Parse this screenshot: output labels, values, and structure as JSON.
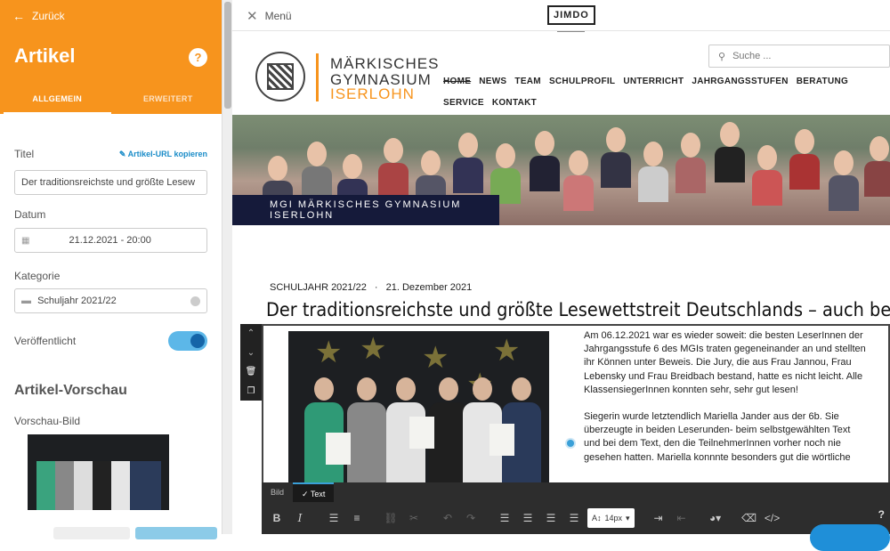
{
  "sidebar": {
    "back_label": "Zurück",
    "title": "Artikel",
    "help_label": "?",
    "tabs": [
      "ALLGEMEIN",
      "ERWEITERT"
    ],
    "title_field_label": "Titel",
    "copy_url_label": "Artikel-URL kopieren",
    "title_value": "Der traditionsreichste und größte Lesew",
    "date_label": "Datum",
    "date_value": "21.12.2021 - 20:00",
    "category_label": "Kategorie",
    "category_value": "Schuljahr 2021/22",
    "published_label": "Veröffentlicht",
    "published": true,
    "preview_heading": "Artikel-Vorschau",
    "preview_image_label": "Vorschau-Bild"
  },
  "topbar": {
    "menu_label": "Menü",
    "brand": "JIMDO"
  },
  "site": {
    "logo": [
      "MÄRKISCHES",
      "GYMNASIUM",
      "ISERLOHN"
    ],
    "search_placeholder": "Suche ...",
    "nav": [
      "HOME",
      "NEWS",
      "TEAM",
      "SCHULPROFIL",
      "UNTERRICHT",
      "JAHRGANGSSTUFEN",
      "BERATUNG",
      "SERVICE",
      "KONTAKT"
    ],
    "hero_caption": "MGI MÄRKISCHES GYMNASIUM ISERLOHN",
    "post_category": "SCHULJAHR 2021/22",
    "post_date": "21. Dezember 2021",
    "post_title": "Der traditionsreichste und größte Lesewettstreit Deutschlands – auch bei uns am MGI",
    "paragraph1": "Am 06.12.2021 war es wieder soweit: die besten LeserInnen der Jahrgangsstufe 6 des MGIs traten gegeneinander an und stellten ihr Können unter Beweis. Die Jury, die aus Frau Jannou, Frau Lebensky und Frau Breidbach bestand, hatte es nicht leicht. Alle KlassensiegerInnen konnten sehr, sehr gut lesen!",
    "paragraph2": "Siegerin wurde letztendlich Mariella Jander aus der 6b. Sie überzeugte in beiden Leserunden- beim selbstgewählten Text und bei dem Text, den die TeilnehmerInnen vorher noch nie gesehen hatten. Mariella konnnte besonders gut die wörtliche"
  },
  "editor": {
    "tabs": [
      "Bild",
      "Text"
    ],
    "font_size": "14px",
    "help": "?"
  },
  "colors": {
    "accent": "#f7941d",
    "toggle_on": "#5cb7e8",
    "hero_caption_bg": "#151a3a",
    "editor_bar": "#2d2d2d"
  }
}
